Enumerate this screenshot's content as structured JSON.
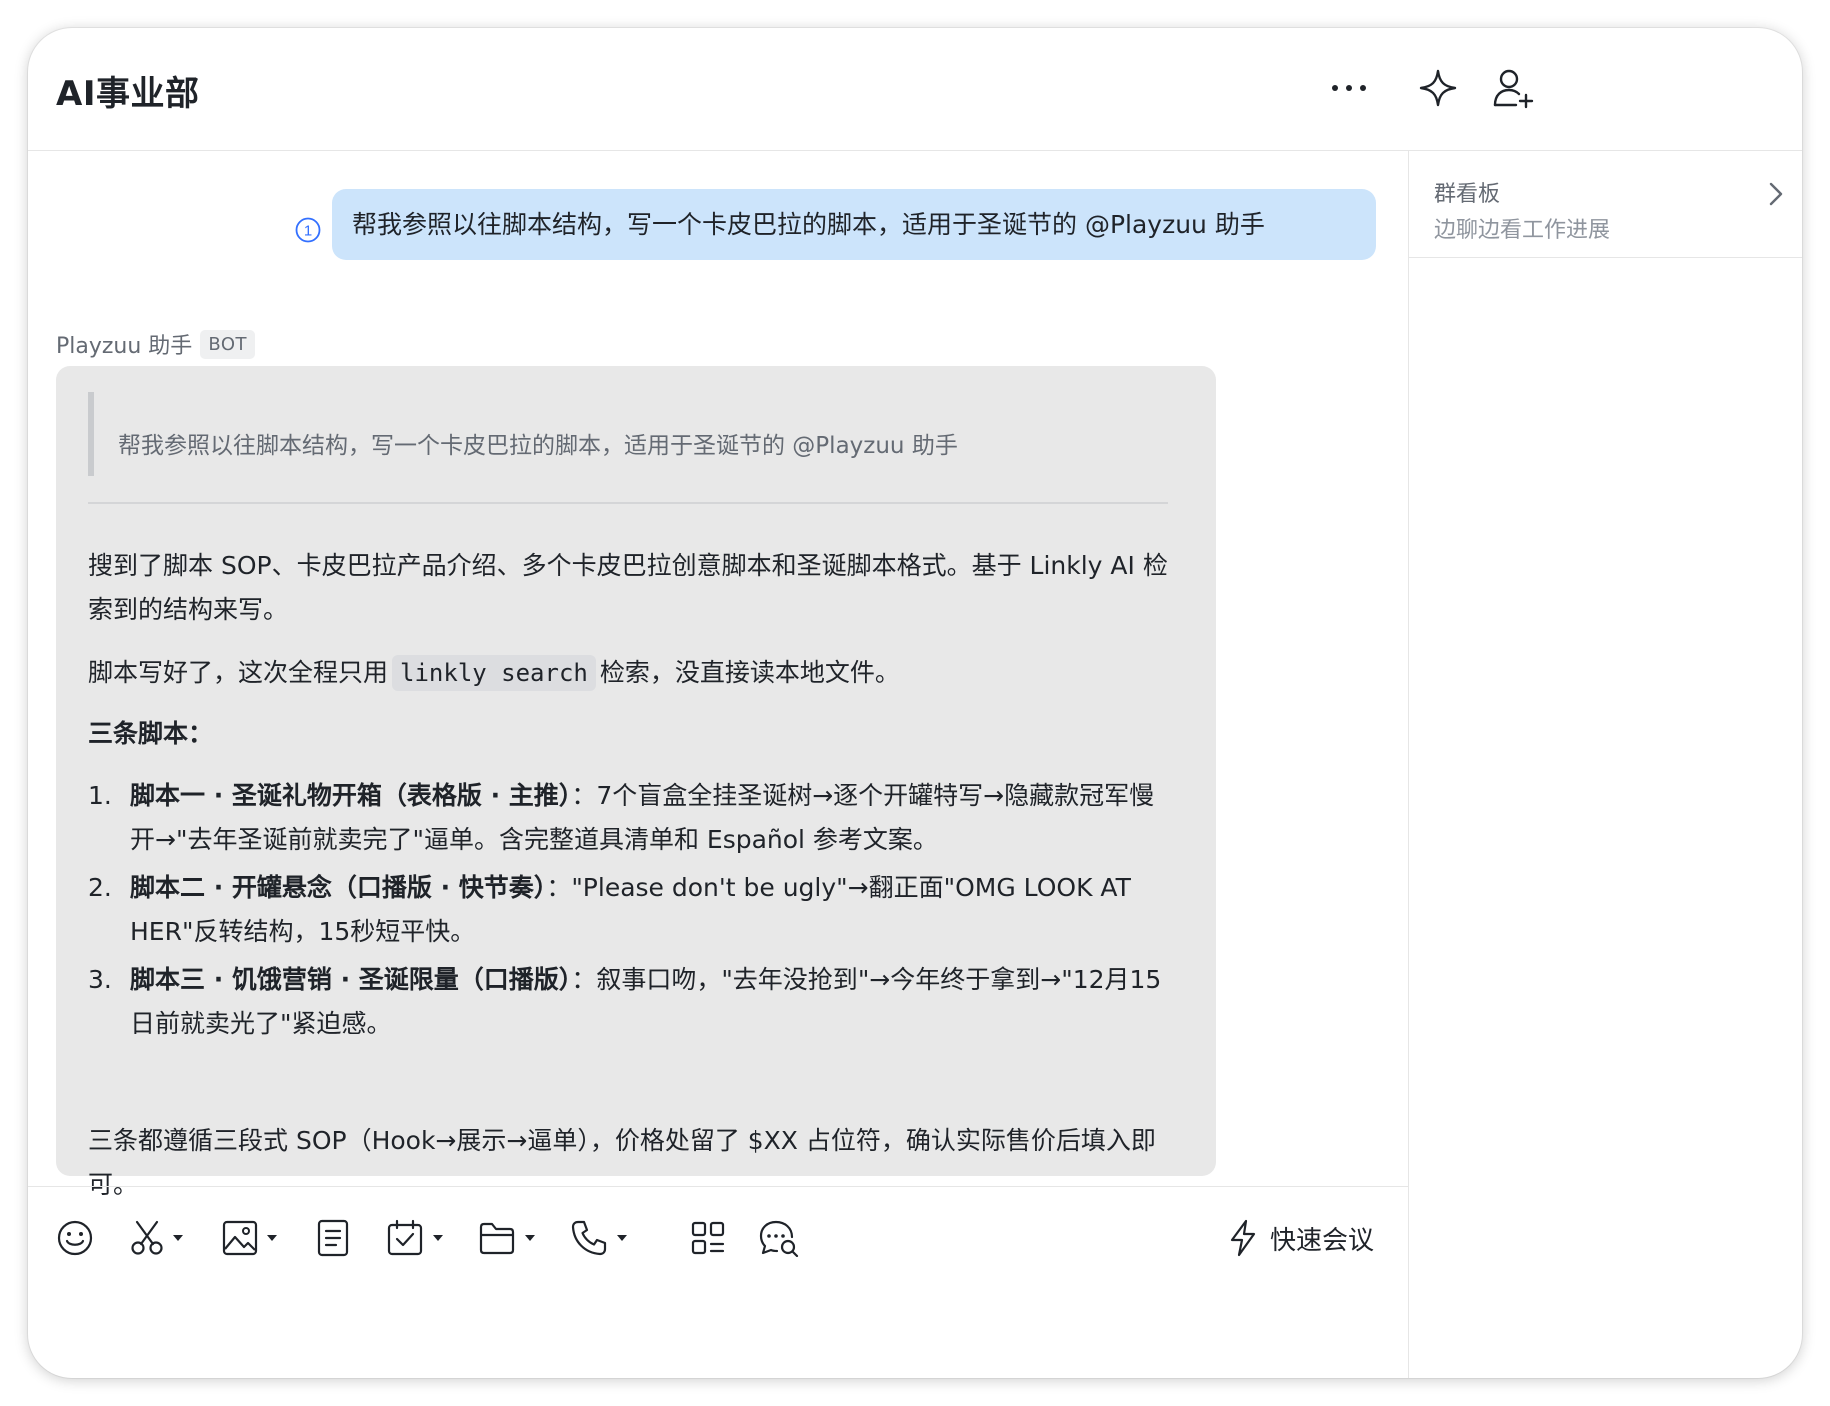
{
  "header": {
    "title": "AI事业部",
    "icons": [
      "more-icon",
      "sparkle-icon",
      "add-member-icon"
    ]
  },
  "right_panel": {
    "board_title": "群看板",
    "board_subtitle": "边聊边看工作进展"
  },
  "my_message": {
    "text": "帮我参照以往脚本结构，写一个卡皮巴拉的脚本，适用于圣诞节的 @Playzuu 助手",
    "read_count": "1"
  },
  "bot_message": {
    "sender": "Playzuu 助手",
    "tag": "BOT",
    "quote": "帮我参照以往脚本结构，写一个卡皮巴拉的脚本，适用于圣诞节的 @Playzuu 助手",
    "para1": "搜到了脚本 SOP、卡皮巴拉产品介绍、多个卡皮巴拉创意脚本和圣诞脚本格式。基于 Linkly AI 检索到的结构来写。",
    "para2_before": "脚本写好了，这次全程只用",
    "para2_code": "linkly search",
    "para2_after": "检索，没直接读本地文件。",
    "heading": "三条脚本：",
    "items": [
      {
        "num": "1.",
        "title": "脚本一 · 圣诞礼物开箱（表格版 · 主推）",
        "text": "：7个盲盒全挂圣诞树→逐个开罐特写→隐藏款冠军慢开→\"去年圣诞前就卖完了\"逼单。含完整道具清单和 Español 参考文案。"
      },
      {
        "num": "2.",
        "title": "脚本二 · 开罐悬念（口播版 · 快节奏）",
        "text": "：\"Please don't be ugly\"→翻正面\"OMG LOOK AT HER\"反转结构，15秒短平快。"
      },
      {
        "num": "3.",
        "title": "脚本三 · 饥饿营销 · 圣诞限量（口播版）",
        "text": "：叙事口吻，\"去年没抢到\"→今年终于拿到→\"12月15日前就卖光了\"紧迫感。"
      }
    ],
    "para4": "三条都遵循三段式 SOP（Hook→展示→逼单），价格处留了 $XX 占位符，确认实际售价后填入即可。"
  },
  "toolbar": {
    "icons": [
      "emoji-icon",
      "scissors-icon",
      "image-icon",
      "document-icon",
      "task-icon",
      "folder-icon",
      "phone-icon",
      "apps-icon",
      "chat-search-icon"
    ],
    "quick_meeting_label": "快速会议"
  },
  "colors": {
    "my_bubble": "#cce4fb",
    "bot_bubble": "#e8e8e8",
    "read_mark": "#3370ff"
  }
}
